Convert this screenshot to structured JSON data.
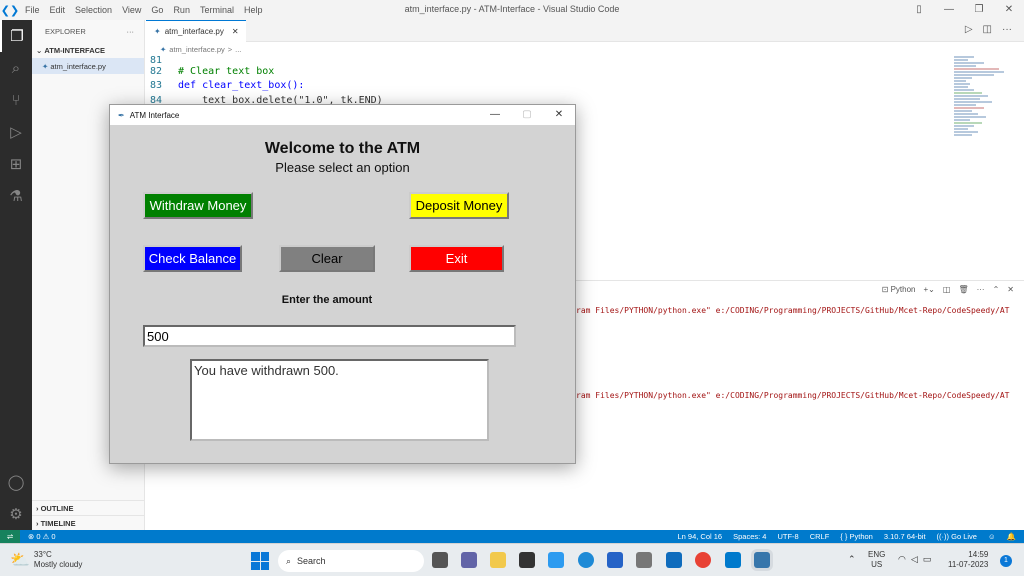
{
  "vscode": {
    "title": "atm_interface.py - ATM-Interface - Visual Studio Code",
    "menu": [
      "File",
      "Edit",
      "Selection",
      "View",
      "Go",
      "Run",
      "Terminal",
      "Help"
    ],
    "explorer_title": "EXPLORER",
    "explorer_more": "···",
    "project_folder": "ATM-INTERFACE",
    "file_name": "atm_interface.py",
    "tab_label": "atm_interface.py",
    "breadcrumb": [
      "atm_interface.py",
      ">",
      "..."
    ],
    "outline_label": "OUTLINE",
    "timeline_label": "TIMELINE",
    "code_lines": [
      {
        "num": "81",
        "text": ""
      },
      {
        "num": "82",
        "text": "# Clear text box"
      },
      {
        "num": "83",
        "text": "def clear_text_box():"
      },
      {
        "num": "84",
        "text": "    text_box.delete(\"1.0\", tk.END)"
      }
    ],
    "panel": {
      "terminal_kind": "Python",
      "line1": "ram Files/PYTHON/python.exe\" e:/CODING/Programming/PROJECTS/GitHub/Mcet-Repo/CodeSpeedy/AT",
      "line2": "ram Files/PYTHON/python.exe\" e:/CODING/Programming/PROJECTS/GitHub/Mcet-Repo/CodeSpeedy/AT"
    },
    "status": {
      "problems": "⊗ 0 ⚠ 0",
      "position": "Ln 94, Col 16",
      "spaces": "Spaces: 4",
      "encoding": "UTF-8",
      "eol": "CRLF",
      "language": "Python",
      "interpreter": "3.10.7 64-bit",
      "golive": "Go Live"
    }
  },
  "atm": {
    "window_title": "ATM Interface",
    "heading": "Welcome to the ATM",
    "subheading": "Please select an option",
    "btn_withdraw": "Withdraw Money",
    "btn_deposit": "Deposit Money",
    "btn_balance": "Check Balance",
    "btn_clear": "Clear",
    "btn_exit": "Exit",
    "amount_label": "Enter the amount",
    "amount_value": "500",
    "output_text": "You have withdrawn 500."
  },
  "taskbar": {
    "weather_temp": "33°C",
    "weather_desc": "Mostly cloudy",
    "search_placeholder": "Search",
    "lang1": "ENG",
    "lang2": "US",
    "time": "14:59",
    "date": "11-07-2023",
    "notif_count": "1"
  },
  "colors": {
    "withdraw_bg": "#008000",
    "deposit_bg": "#ffff00",
    "balance_bg": "#0000ff",
    "clear_bg": "#808080",
    "exit_bg": "#ff0000",
    "statusbar": "#007acc"
  }
}
